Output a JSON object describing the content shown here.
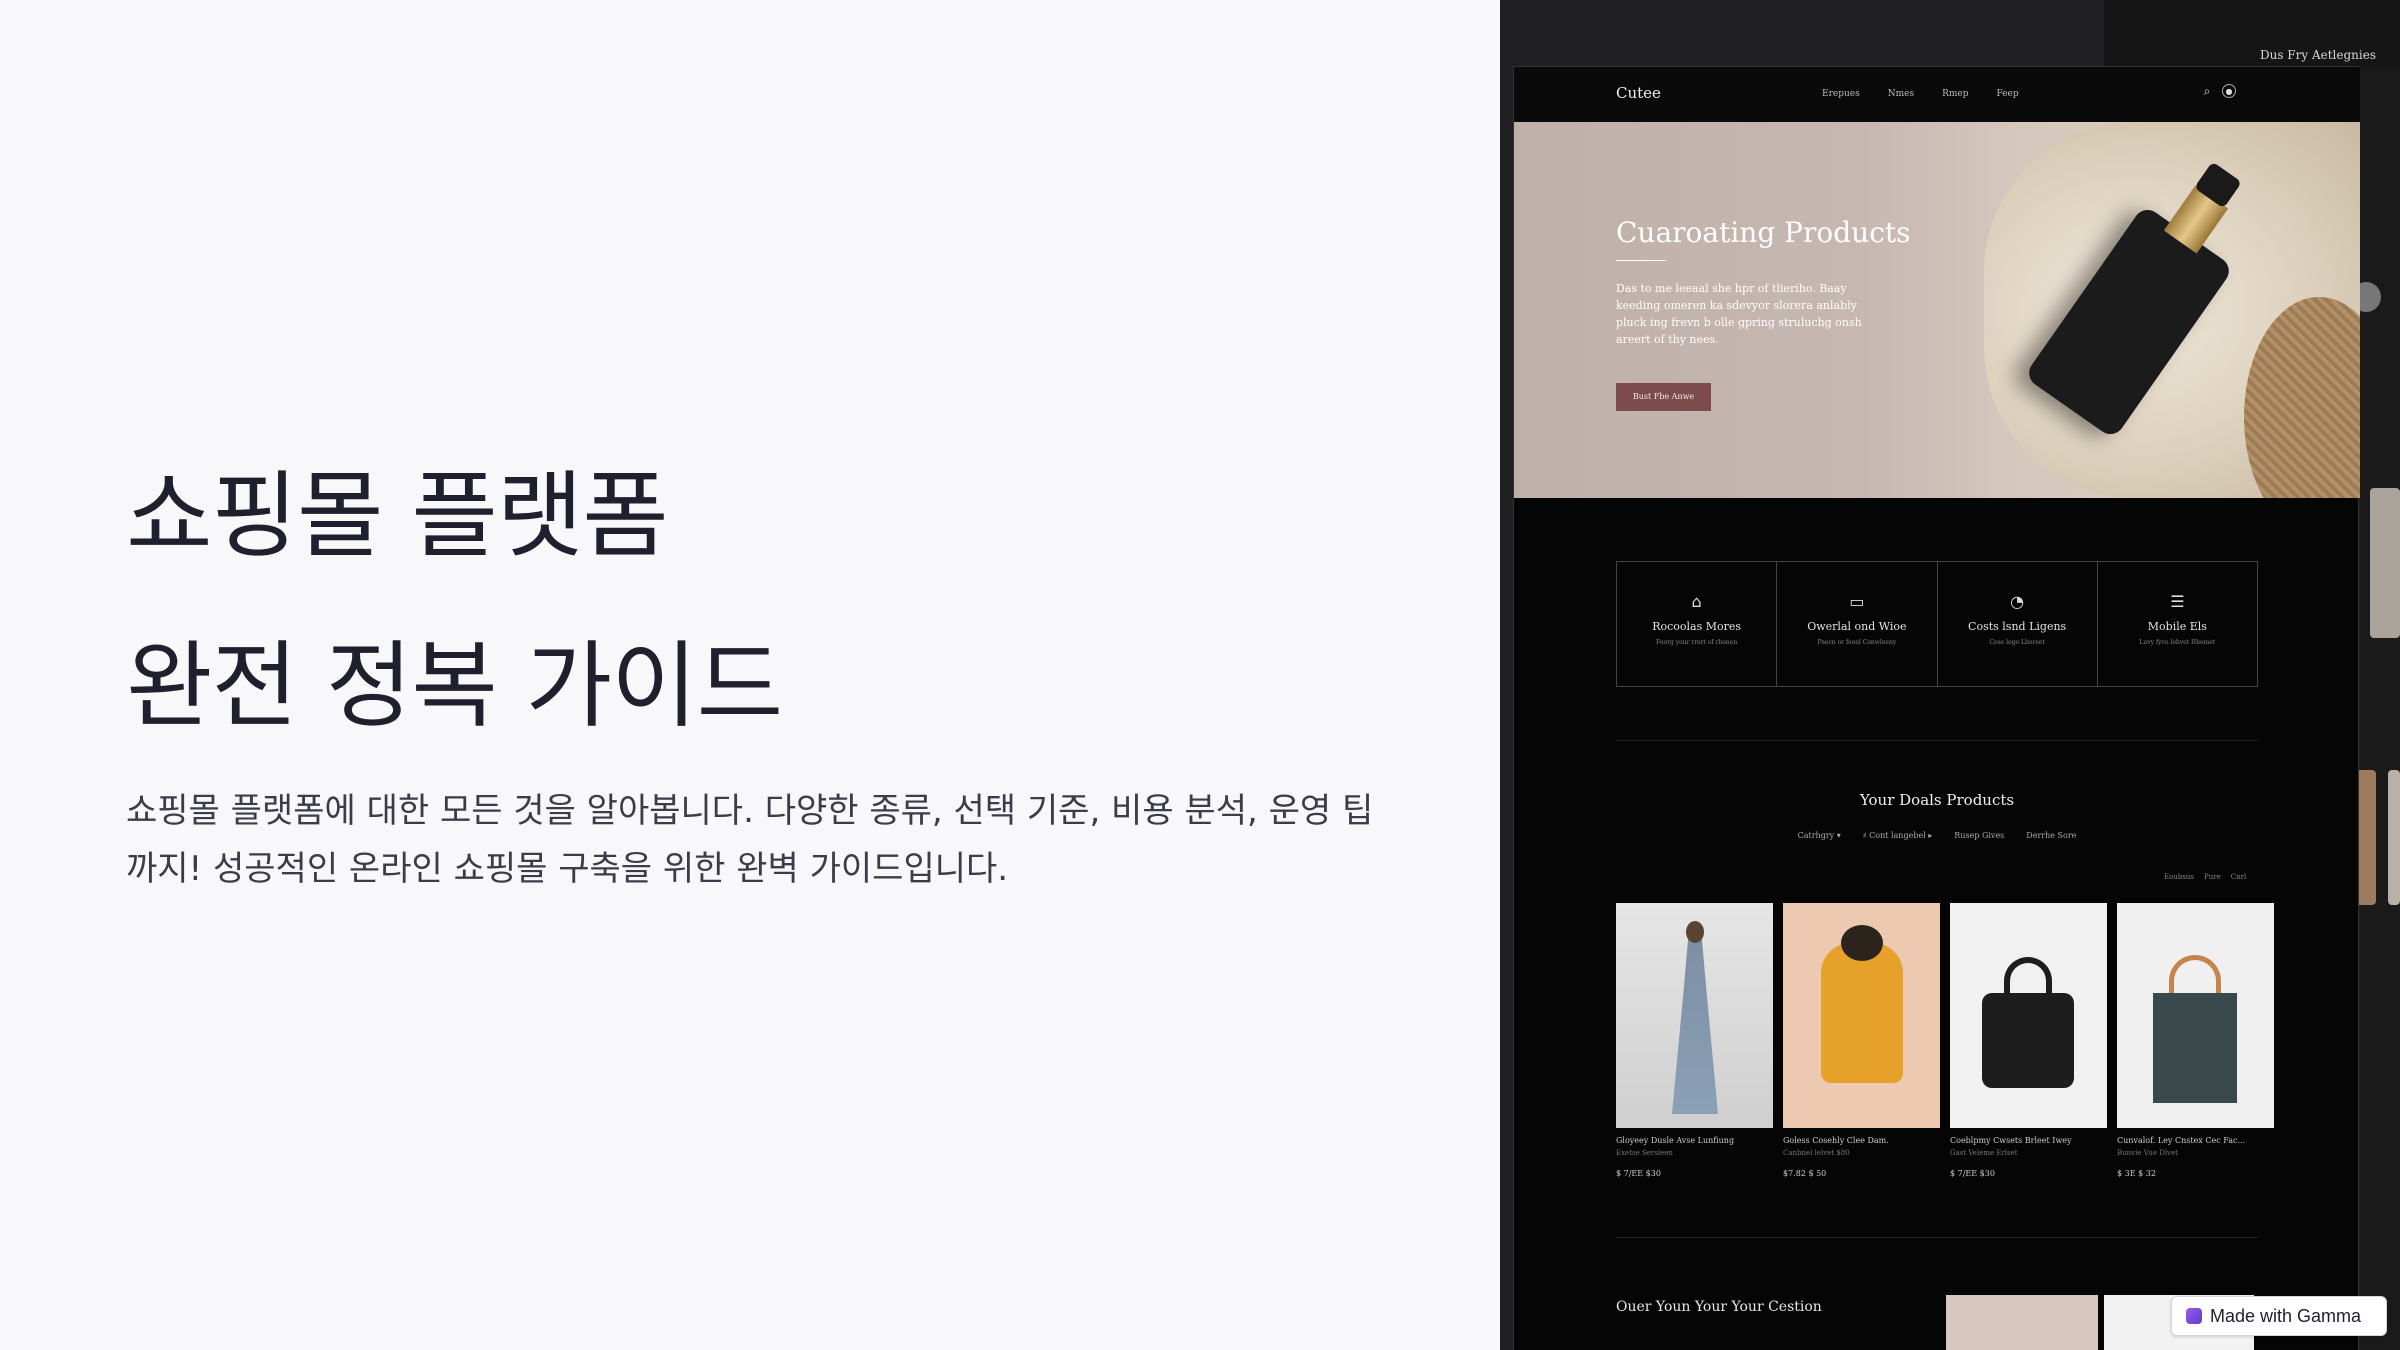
{
  "hero": {
    "title_line1": "쇼핑몰 플랫폼",
    "title_line2": "완전 정복 가이드",
    "description": "쇼핑몰 플랫폼에 대한 모든 것을 알아봅니다. 다양한 종류, 선택 기준, 비용 분석, 운영 팁까지! 성공적인 온라인 쇼핑몰 구축을 위한 완벽 가이드입니다."
  },
  "screenshot": {
    "background_label": "Dus Fry Aetlegnies",
    "site": {
      "logo": "Cutee",
      "nav_links": [
        "Erepues",
        "Nmes",
        "Rmep",
        "Feep"
      ],
      "nav_search_icon": "search-icon",
      "nav_user_icon": "user-icon",
      "hero_title": "Cuaroating Products",
      "hero_text": "Das to me leeaal she hpr of tlieriho. Baay keeding omeren ka sdevyor slorera anlably pluck ing frevn b olle gpring struluchg onsh areert of thy nees.",
      "hero_button": "Bust Fbe Anwe",
      "features": [
        {
          "icon": "⌂",
          "title": "Rocoolas Mores",
          "sub": "Foorg your rrert of rhonen"
        },
        {
          "icon": "▭",
          "title": "Owerlal ond Wioe",
          "sub": "Paecn or feoel Conwleeny"
        },
        {
          "icon": "◔",
          "title": "Costs lsnd Ligens",
          "sub": "Cose logo Lboreet"
        },
        {
          "icon": "☰",
          "title": "Mobile Els",
          "sub": "Luvy fyve lobvet Hhemet"
        }
      ],
      "section_title": "Your Doals Products",
      "filters": [
        "Catrhgry ▾",
        "♯ Cont langebel ▸",
        "Rusep Gives",
        "Derrhe Sore"
      ],
      "sort_links": [
        "Eoubsus",
        "Pure",
        "Cnrl"
      ],
      "products": [
        {
          "name": "Gloyeey Dusle Avse Lunfiung",
          "sub": "Exetse Sersleen",
          "price": "$ 7/EE $30"
        },
        {
          "name": "Goless Cosehly Clee Dam.",
          "sub": "Canbnel lelvet $80",
          "price": "$7.82 $ 50"
        },
        {
          "name": "Coeblpmy Cwsets Brleet Iwey",
          "sub": "Gast Veleme Erlset",
          "price": "$ 7/EE $30"
        },
        {
          "name": "Cunvalof. Ley Cnstex Cec Fac...",
          "sub": "Bunvie Vue Dlvet",
          "price": "$ 3E $ 32"
        }
      ],
      "bottom_title": "Ouer Youn Your Your Cestion"
    }
  },
  "badge": {
    "label": "Made with Gamma",
    "icon": "gamma-logo-icon"
  }
}
